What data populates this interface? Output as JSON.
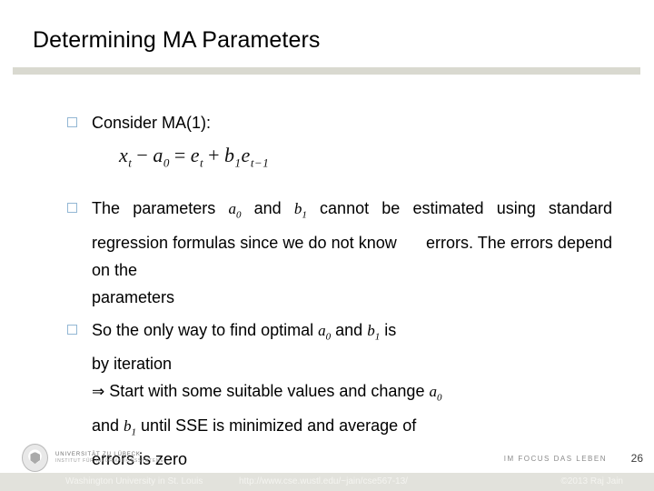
{
  "slide": {
    "title": "Determining MA Parameters",
    "page_number": "26"
  },
  "bullets": {
    "b1": {
      "lead": "Consider MA(1):",
      "equation": {
        "lhs_var": "x",
        "lhs_sub": "t",
        "minus": "−",
        "a_var": "a",
        "a_sub": "0",
        "equals": "=",
        "e_var": "e",
        "e_sub": "t",
        "plus": "+",
        "b_var": "b",
        "b_sub": "1",
        "e2_var": "e",
        "e2_sub": "t−1"
      }
    },
    "b2": {
      "seg1": "The parameters ",
      "a_var": "a",
      "a_sub": "0",
      "seg2": " and ",
      "b_var": "b",
      "b_sub": "1",
      "seg3": " cannot be estimated using standard regression formulas since we do not know ",
      "seg4": " errors. The errors depend on the ",
      "seg5": "parameters"
    },
    "b3": {
      "seg1": "So the only way to find optimal ",
      "a_var": "a",
      "a_sub": "0",
      "seg2": " and ",
      "b_var": "b",
      "b_sub": "1",
      "seg3": " is",
      "line2": "by iteration",
      "arrow": "⇒",
      "line3a": " Start with some suitable values and change ",
      "a2_var": "a",
      "a2_sub": "0",
      "line4a": "and ",
      "b2_var": "b",
      "b2_sub": "1",
      "line4b": " until SSE is minimized and average of",
      "line5": "errors is  zero"
    }
  },
  "footer": {
    "university_name": "Universität zu Lübeck",
    "university_dept": "Institut für Informationssysteme",
    "tagline": "IM FOCUS DAS LEBEN",
    "bar_left": "Washington University in St. Louis",
    "bar_url": "http://www.cse.wustl.edu/~jain/cse567-13/",
    "bar_copyright": "©2013 Raj Jain"
  },
  "colors": {
    "rule": "#d9d9d0",
    "bullet_marker": "#93b7d4",
    "footer_bar": "#e2e2dc",
    "footer_text": "#f4f4f0"
  }
}
